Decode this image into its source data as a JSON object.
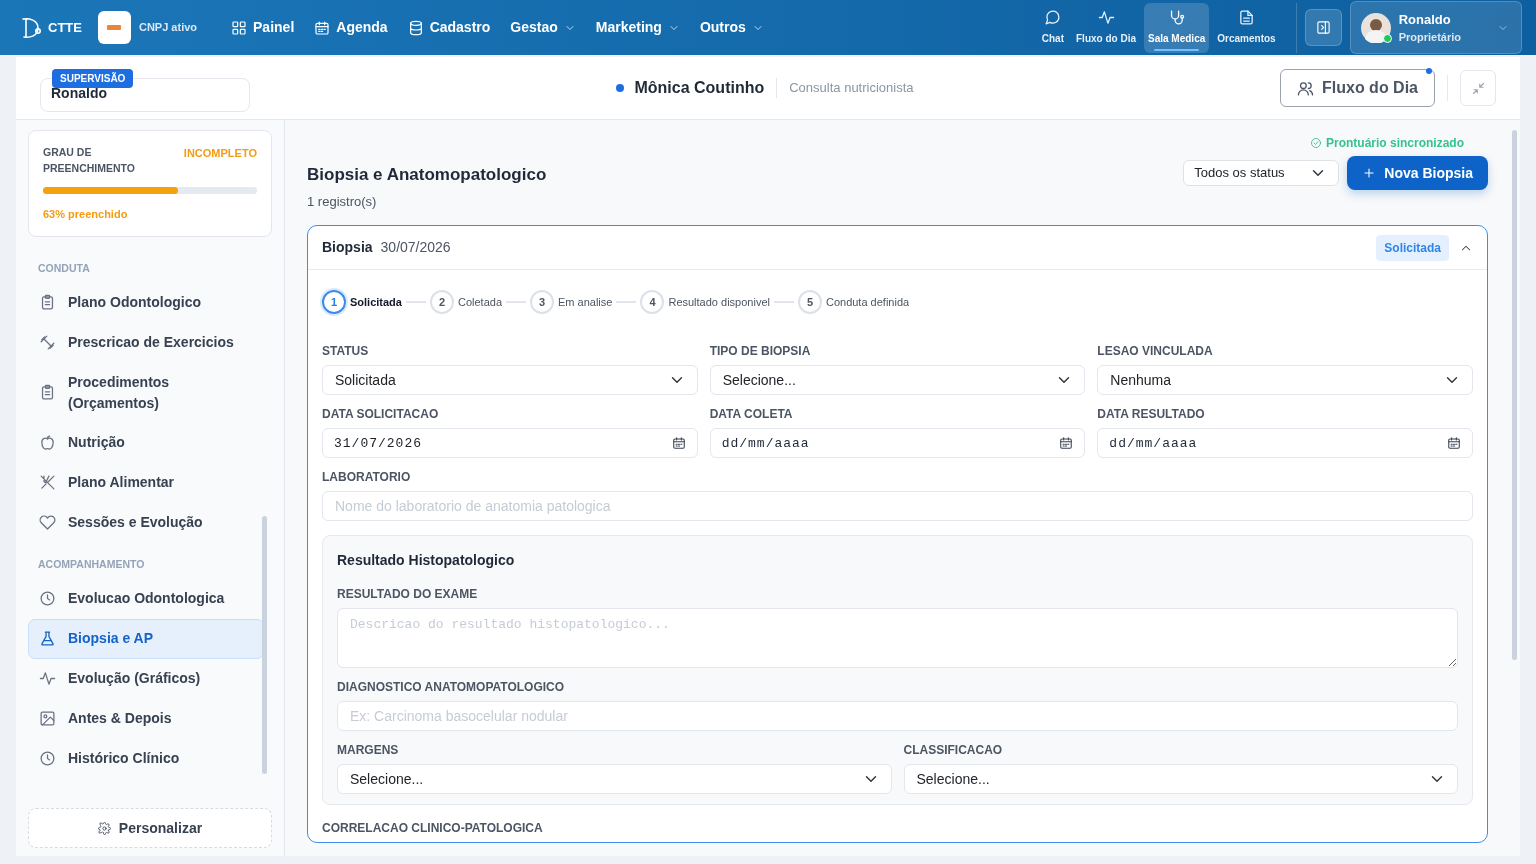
{
  "brand": {
    "logo_text": "CTTE",
    "company_status": "CNPJ ativo"
  },
  "nav": [
    {
      "label": "Painel",
      "dropdown": false
    },
    {
      "label": "Agenda",
      "dropdown": false
    },
    {
      "label": "Cadastro",
      "dropdown": false
    },
    {
      "label": "Gestao",
      "dropdown": true
    },
    {
      "label": "Marketing",
      "dropdown": true
    },
    {
      "label": "Outros",
      "dropdown": true
    }
  ],
  "quick_links": [
    {
      "label": "Chat",
      "selected": false
    },
    {
      "label": "Fluxo do Dia",
      "selected": false
    },
    {
      "label": "Sala Medica",
      "selected": true
    },
    {
      "label": "Orcamentos",
      "selected": false
    }
  ],
  "user": {
    "name": "Ronaldo",
    "role": "Proprietário",
    "online": true
  },
  "supervision": {
    "badge": "SUPERVISÃO",
    "name": "Ronaldo"
  },
  "patient": {
    "name": "Mônica Coutinho",
    "consultation": "Consulta nutricionista"
  },
  "flow_button": {
    "label": "Fluxo do Dia",
    "notification": true
  },
  "completion": {
    "title": "GRAU DE PREENCHIMENTO",
    "status": "INCOMPLETO",
    "level": 0.63,
    "reading": "63% preenchido"
  },
  "sidebar": {
    "sections": [
      {
        "title": "CONDUTA",
        "items": [
          {
            "label": "Plano Odontologico",
            "selected": false
          },
          {
            "label": "Prescricao de Exercicios",
            "selected": false
          },
          {
            "label": "Procedimentos (Orçamentos)",
            "selected": false
          },
          {
            "label": "Nutrição",
            "selected": false
          },
          {
            "label": "Plano Alimentar",
            "selected": false
          },
          {
            "label": "Sessões e Evolução",
            "selected": false
          }
        ]
      },
      {
        "title": "ACOMPANHAMENTO",
        "items": [
          {
            "label": "Evolucao Odontologica",
            "selected": false
          },
          {
            "label": "Biopsia e AP",
            "selected": true
          },
          {
            "label": "Evolução (Gráficos)",
            "selected": false
          },
          {
            "label": "Antes & Depois",
            "selected": false
          },
          {
            "label": "Histórico Clínico",
            "selected": false
          }
        ]
      }
    ],
    "customize": "Personalizar"
  },
  "main": {
    "sync_status": "Prontuário sincronizado",
    "title": "Biopsia e Anatomopatologico",
    "count": "1 registro(s)",
    "filter": "Todos os status",
    "new_button": "Nova Biopsia"
  },
  "record": {
    "title": "Biopsia",
    "date": "30/07/2026",
    "status_badge": "Solicitada",
    "expanded": true,
    "steps": [
      {
        "number": "1",
        "label": "Solicitada",
        "selected": true
      },
      {
        "number": "2",
        "label": "Coletada",
        "selected": false
      },
      {
        "number": "3",
        "label": "Em analise",
        "selected": false
      },
      {
        "number": "4",
        "label": "Resultado disponivel",
        "selected": false
      },
      {
        "number": "5",
        "label": "Conduta definida",
        "selected": false
      }
    ],
    "fields": [
      {
        "label": "STATUS",
        "kind": "select",
        "value": "Solicitada"
      },
      {
        "label": "TIPO DE BIOPSIA",
        "kind": "select",
        "value": "Selecione..."
      },
      {
        "label": "LESAO VINCULADA",
        "kind": "select",
        "value": "Nenhuma"
      },
      {
        "label": "DATA SOLICITACAO",
        "kind": "date",
        "value": "31/07/2026"
      },
      {
        "label": "DATA COLETA",
        "kind": "date",
        "placeholder": "dd/mm/aaaa"
      },
      {
        "label": "DATA RESULTADO",
        "kind": "date",
        "placeholder": "dd/mm/aaaa"
      },
      {
        "label": "LABORATORIO",
        "kind": "text",
        "placeholder": "Nome do laboratorio de anatomia patologica"
      }
    ],
    "result": {
      "title": "Resultado Histopatologico",
      "fields": [
        {
          "label": "RESULTADO DO EXAME",
          "kind": "textarea",
          "placeholder": "Descricao do resultado histopatologico..."
        },
        {
          "label": "DIAGNOSTICO ANATOMOPATOLOGICO",
          "kind": "text",
          "placeholder": "Ex: Carcinoma basocelular nodular"
        },
        {
          "label": "MARGENS",
          "kind": "select",
          "value": "Selecione..."
        },
        {
          "label": "CLASSIFICACAO",
          "kind": "select",
          "value": "Selecione..."
        }
      ]
    },
    "next_label": "CORRELACAO CLINICO-PATOLOGICA"
  }
}
